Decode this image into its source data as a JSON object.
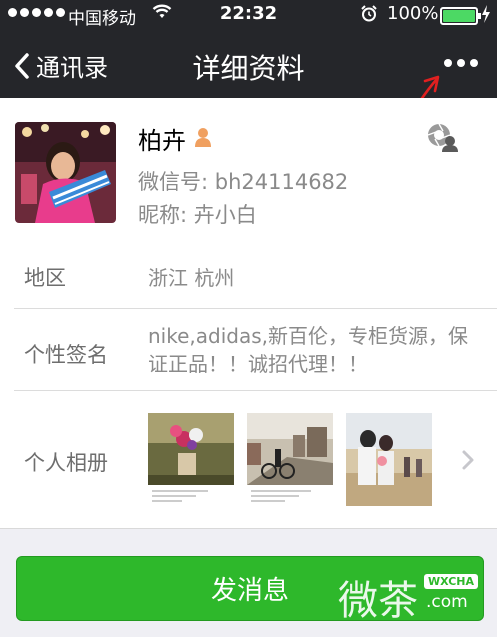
{
  "status_bar": {
    "carrier": "中国移动",
    "time": "22:32",
    "battery": "100%",
    "battery_level": 1.0,
    "signal_bars": 5
  },
  "nav": {
    "back_label": "通讯录",
    "title": "详细资料",
    "more_icon": "more-dots-icon"
  },
  "profile": {
    "name": "柏卉",
    "wechat_id": "微信号:  bh24114682",
    "nickname": "昵称:  卉小白",
    "gender_icon": "female-icon"
  },
  "details": {
    "region_label": "地区",
    "region_value": "浙江 杭州",
    "signature_label": "个性签名",
    "signature_value": "nike,adidas,新百伦，专柜货源，保证正品！！诚招代理！！",
    "album_label": "个人相册"
  },
  "actions": {
    "send_label": "发消息"
  },
  "watermark": {
    "cn": "微茶",
    "tag": "WXCHA",
    "com": ".com"
  },
  "colors": {
    "nav_bg": "#25262a",
    "accent_green": "#2eb82b",
    "annotation_red": "#e02020"
  }
}
